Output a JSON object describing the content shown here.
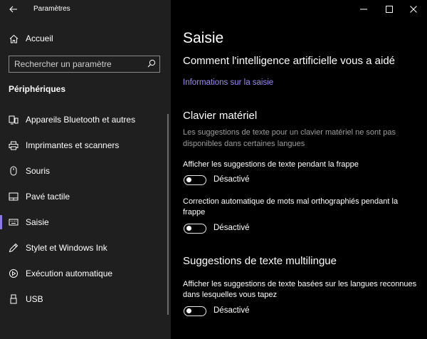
{
  "window": {
    "app_title": "Paramètres",
    "back_icon": "arrow-left-icon",
    "controls": [
      "minimize-icon",
      "maximize-icon",
      "close-icon"
    ]
  },
  "sidebar": {
    "home_label": "Accueil",
    "search": {
      "placeholder": "Rechercher un paramètre"
    },
    "section_title": "Périphériques",
    "items": [
      {
        "label": "Appareils Bluetooth et autres",
        "icon": "devices-icon"
      },
      {
        "label": "Imprimantes et scanners",
        "icon": "printer-icon"
      },
      {
        "label": "Souris",
        "icon": "mouse-icon"
      },
      {
        "label": "Pavé tactile",
        "icon": "touchpad-icon"
      },
      {
        "label": "Saisie",
        "icon": "keyboard-icon",
        "selected": true
      },
      {
        "label": "Stylet et Windows Ink",
        "icon": "pen-icon"
      },
      {
        "label": "Exécution automatique",
        "icon": "autoplay-icon"
      },
      {
        "label": "USB",
        "icon": "usb-icon"
      }
    ]
  },
  "main": {
    "title": "Saisie",
    "ai_heading": "Comment l'intelligence artificielle vous a aidé",
    "info_link": "Informations sur la saisie",
    "hardware_keyboard": {
      "heading": "Clavier matériel",
      "description": "Les suggestions de texte pour un clavier matériel ne sont pas disponibles dans certaines langues",
      "settings": [
        {
          "label": "Afficher les suggestions de texte pendant la frappe",
          "state": "Désactivé"
        },
        {
          "label": "Correction automatique de mots mal orthographiés pendant la frappe",
          "state": "Désactivé"
        }
      ]
    },
    "multilingual": {
      "heading": "Suggestions de texte multilingue",
      "settings": [
        {
          "label": "Afficher les suggestions de texte basées sur les langues reconnues dans lesquelles vous tapez",
          "state": "Désactivé"
        }
      ]
    }
  },
  "colors": {
    "accent": "#8a7ddb",
    "link": "#9b8cf2",
    "sidebar_bg": "#1f1f1f",
    "main_bg": "#000000"
  }
}
